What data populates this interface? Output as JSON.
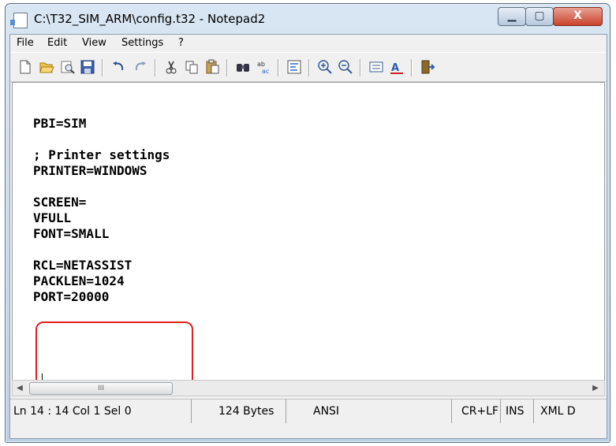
{
  "window": {
    "title": "C:\\T32_SIM_ARM\\config.t32 - Notepad2"
  },
  "controls": {
    "minimize": "▁",
    "maximize": "▢",
    "close": "X"
  },
  "menu": [
    {
      "label": "File"
    },
    {
      "label": "Edit"
    },
    {
      "label": "View"
    },
    {
      "label": "Settings"
    },
    {
      "label": "?"
    }
  ],
  "toolbar": {
    "buttons": [
      "new-icon",
      "open-icon",
      "browse-icon",
      "save-icon",
      "undo-icon",
      "redo-icon",
      "cut-icon",
      "copy-icon",
      "paste-icon",
      "find-icon",
      "replace-icon",
      "wrap-icon",
      "zoom-in-icon",
      "zoom-out-icon",
      "scheme-icon",
      "font-icon",
      "exit-icon"
    ]
  },
  "editor": {
    "content": "PBI=SIM\n\n; Printer settings\nPRINTER=WINDOWS\n\nSCREEN=\nVFULL\nFONT=SMALL\n\nRCL=NETASSIST\nPACKLEN=1024\nPORT=20000"
  },
  "scrollbar": {
    "left": "◀",
    "right": "▶",
    "thumb": "III"
  },
  "status": {
    "position": "Ln 14 : 14   Col 1   Sel 0",
    "size": "124 Bytes",
    "encoding": "ANSI",
    "line_endings": "CR+LF",
    "insert_mode": "INS",
    "lexer": "XML D"
  }
}
